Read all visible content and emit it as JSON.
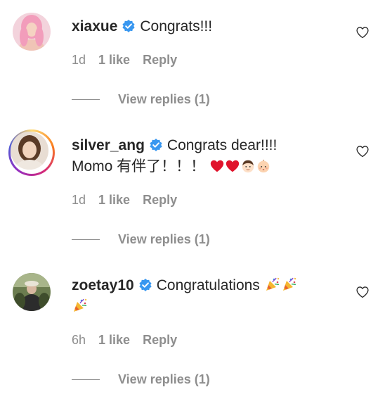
{
  "comments": [
    {
      "username": "xiaxue",
      "text": "Congrats!!!",
      "time": "1d",
      "likes": "1 like",
      "reply": "Reply",
      "view_replies": "View replies (1)"
    },
    {
      "username": "silver_ang",
      "text_line1": "Congrats dear!!!!",
      "text_line2": "Momo 有伴了！！！",
      "time": "1d",
      "likes": "1 like",
      "reply": "Reply",
      "view_replies": "View replies (1)"
    },
    {
      "username": "zoetay10",
      "text": "Congratulations",
      "time": "6h",
      "likes": "1 like",
      "reply": "Reply",
      "view_replies": "View replies (1)"
    }
  ],
  "icons": {
    "verified": "verified-badge-icon",
    "like": "heart-outline-icon",
    "party": "party-popper-emoji",
    "heart_emoji": "red-heart-emoji",
    "boy": "boy-face-emoji",
    "baby": "baby-face-emoji"
  },
  "colors": {
    "verified_blue": "#3897f0",
    "muted": "#8e8e8e",
    "text": "#262626"
  }
}
